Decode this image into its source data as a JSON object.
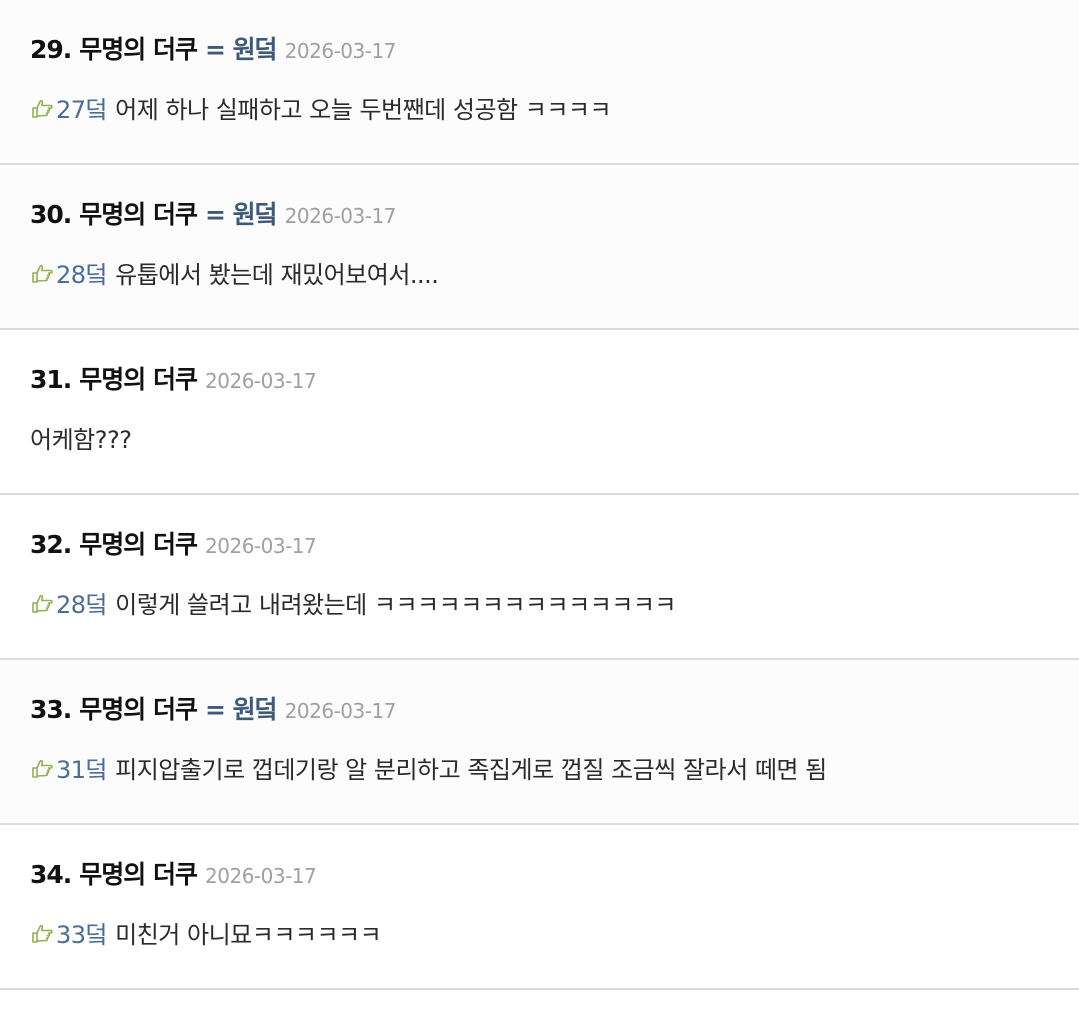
{
  "comments": [
    {
      "number": "29.",
      "author": "무명의 더쿠",
      "op_badge": "= 원덬",
      "date": "2026-03-17",
      "reply_to": "27덬",
      "text": "어제 하나 실패하고 오늘 두번짼데 성공함 ㅋㅋㅋㅋ"
    },
    {
      "number": "30.",
      "author": "무명의 더쿠",
      "op_badge": "= 원덬",
      "date": "2026-03-17",
      "reply_to": "28덬",
      "text": "유툽에서 봤는데 재밌어보여서...."
    },
    {
      "number": "31.",
      "author": "무명의 더쿠",
      "op_badge": "",
      "date": "2026-03-17",
      "reply_to": "",
      "text": "어케함???"
    },
    {
      "number": "32.",
      "author": "무명의 더쿠",
      "op_badge": "",
      "date": "2026-03-17",
      "reply_to": "28덬",
      "text": "이렇게 쓸려고 내려왔는데 ㅋㅋㅋㅋㅋㅋㅋㅋㅋㅋㅋㅋㅋㅋ"
    },
    {
      "number": "33.",
      "author": "무명의 더쿠",
      "op_badge": "= 원덬",
      "date": "2026-03-17",
      "reply_to": "31덬",
      "text": "피지압출기로 껍데기랑 알 분리하고 족집게로 껍질 조금씩 잘라서 떼면 됨"
    },
    {
      "number": "34.",
      "author": "무명의 더쿠",
      "op_badge": "",
      "date": "2026-03-17",
      "reply_to": "33덬",
      "text": "미친거 아니묘ㅋㅋㅋㅋㅋㅋ"
    }
  ],
  "icons": {
    "reply": "thumb-pointing-icon"
  },
  "colors": {
    "op_badge": "#3f5a78",
    "reply_ref": "#4a6d96",
    "reply_icon": "#8fb24f",
    "date": "#a0a0a0",
    "divider": "#dcdcdc"
  }
}
